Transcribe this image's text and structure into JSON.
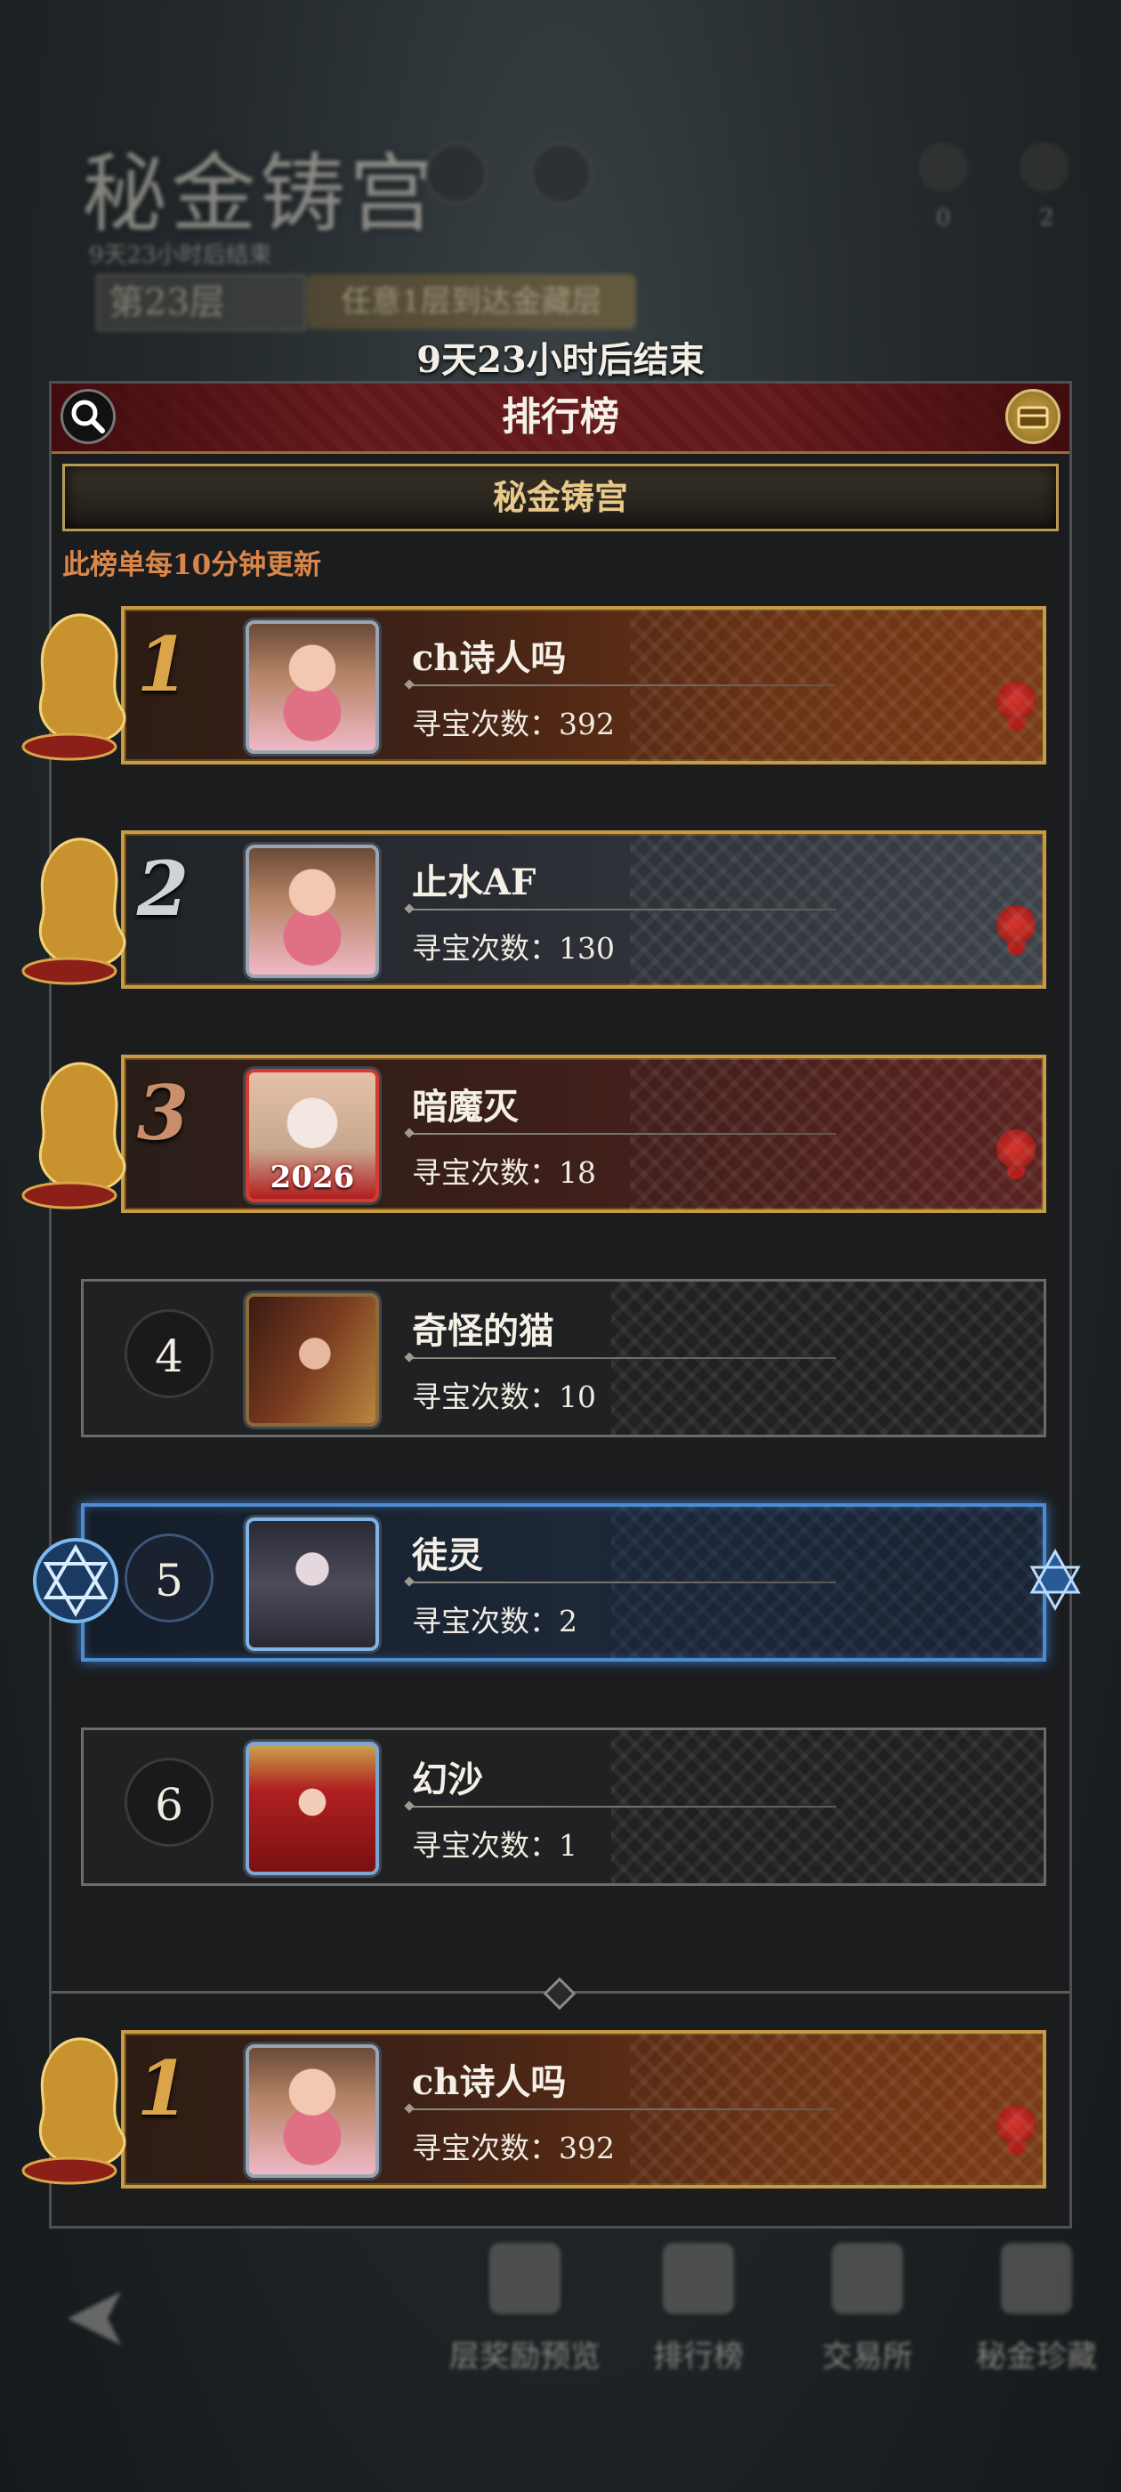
{
  "background": {
    "game_title": "秘金铸宫",
    "subtitle": "9天23小时后结束",
    "floor_label": "第23层",
    "task_label": "任意1层到达金藏层",
    "stats": [
      "0",
      "2"
    ]
  },
  "end_time_text": "9天23小时后结束",
  "panel": {
    "title": "排行榜",
    "tab_label": "秘金铸宫",
    "update_note": "此榜单每10分钟更新"
  },
  "rankings": [
    {
      "rank": "1",
      "name": "ch诗人吗",
      "count_label": "寻宝次数：",
      "count": "392"
    },
    {
      "rank": "2",
      "name": "止水AF",
      "count_label": "寻宝次数：",
      "count": "130"
    },
    {
      "rank": "3",
      "name": "暗魔灭",
      "count_label": "寻宝次数：",
      "count": "18",
      "avatar_text": "2026"
    },
    {
      "rank": "4",
      "name": "奇怪的猫",
      "count_label": "寻宝次数：",
      "count": "10"
    },
    {
      "rank": "5",
      "name": "徒灵",
      "count_label": "寻宝次数：",
      "count": "2"
    },
    {
      "rank": "6",
      "name": "幻沙",
      "count_label": "寻宝次数：",
      "count": "1"
    }
  ],
  "my_rank": {
    "rank": "1",
    "name": "ch诗人吗",
    "count_label": "寻宝次数：",
    "count": "392"
  },
  "bottom_nav": [
    "层奖励预览",
    "排行榜",
    "交易所",
    "秘金珍藏"
  ],
  "colors": {
    "gold": "#c79a45",
    "crimson": "#6b1e22",
    "blue_glow": "#4f8bd0",
    "note_orange": "#d9864a"
  }
}
